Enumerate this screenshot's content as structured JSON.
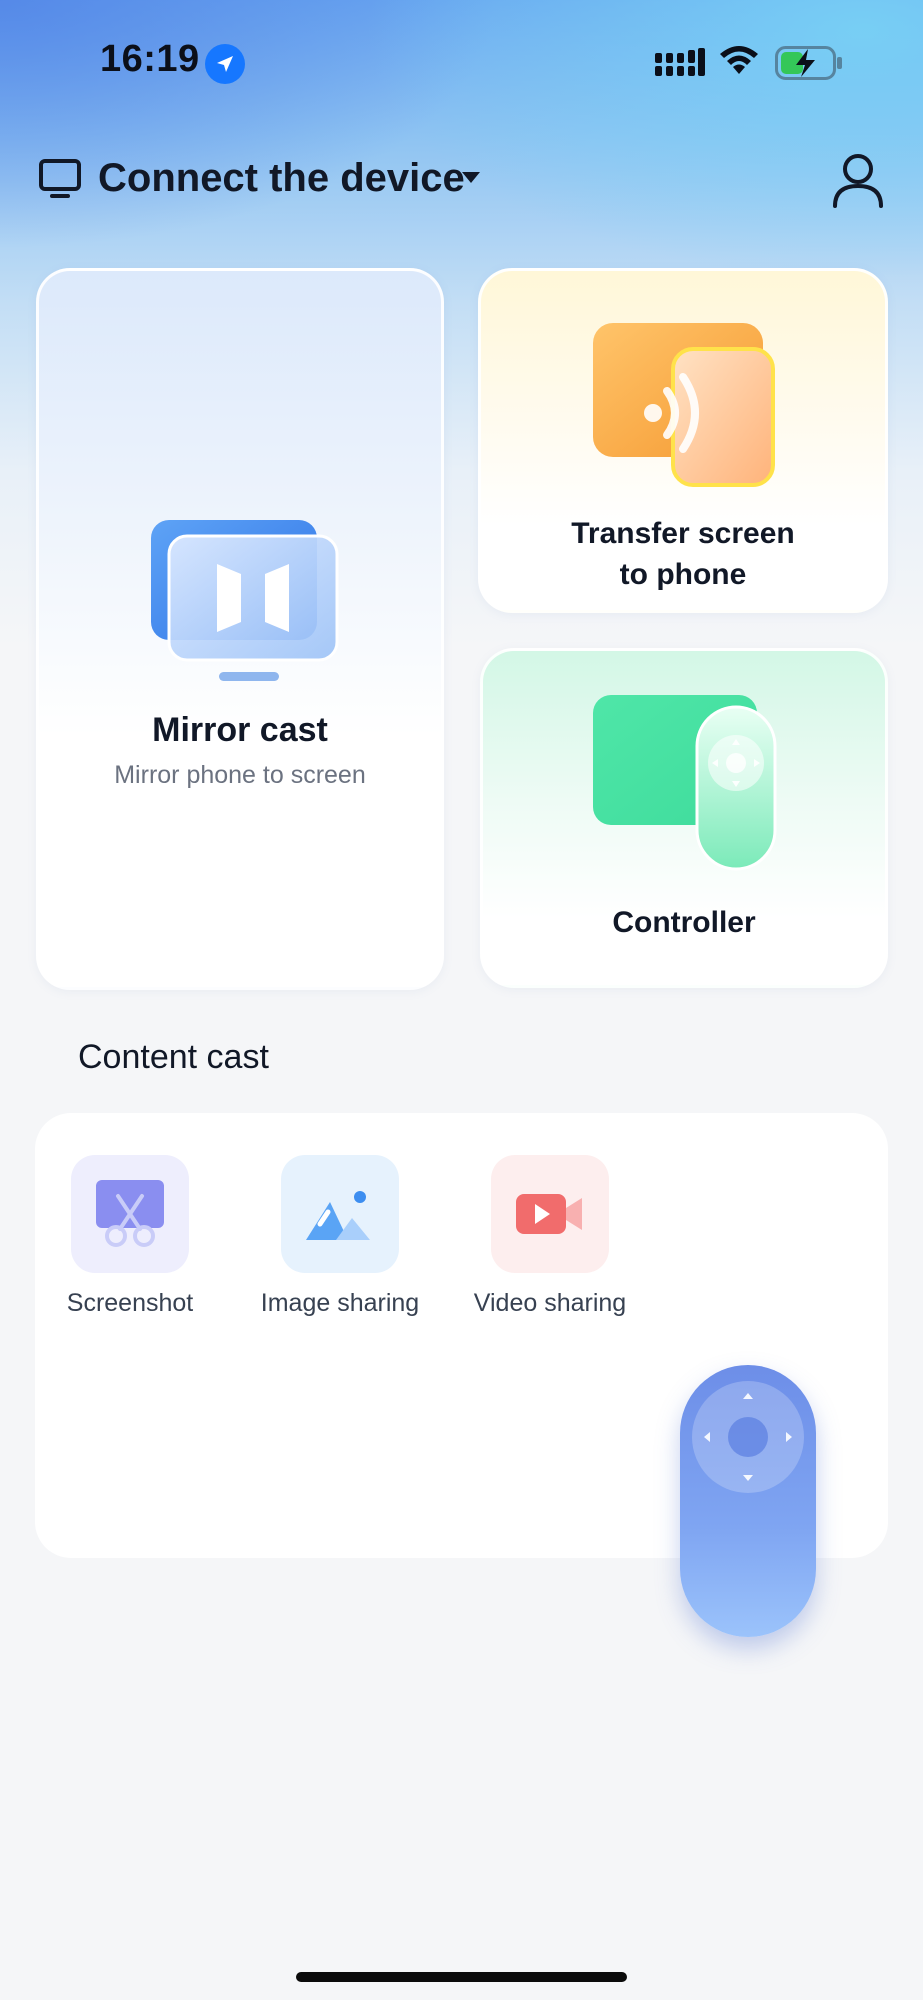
{
  "status_bar": {
    "time": "16:19"
  },
  "header": {
    "title": "Connect the device"
  },
  "cards": {
    "mirror": {
      "title": "Mirror cast",
      "subtitle": "Mirror phone to screen"
    },
    "transfer": {
      "title_line1": "Transfer screen",
      "title_line2": "to phone"
    },
    "controller": {
      "title": "Controller"
    }
  },
  "content_cast": {
    "title": "Content cast",
    "items": [
      {
        "label": "Screenshot",
        "icon": "screenshot-scissors-icon"
      },
      {
        "label": "Image sharing",
        "icon": "image-icon"
      },
      {
        "label": "Video sharing",
        "icon": "video-camera-icon"
      }
    ]
  },
  "colors": {
    "accent_blue": "#1677ff",
    "transfer_orange": "#f7a33a",
    "controller_green": "#43e3a3",
    "remote_blue": "#7fa5f2"
  }
}
